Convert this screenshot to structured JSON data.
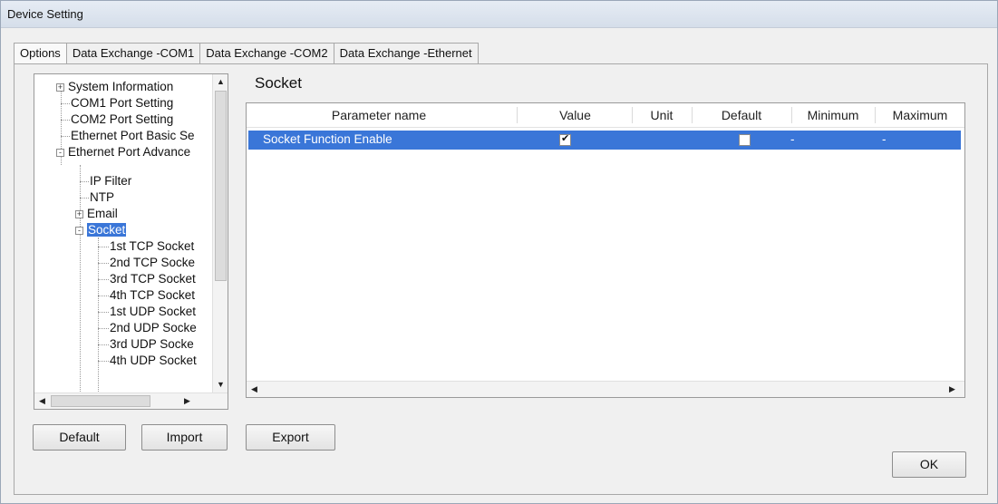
{
  "window": {
    "title": "Device Setting"
  },
  "tabs": [
    "Options",
    "Data Exchange -COM1",
    "Data Exchange -COM2",
    "Data Exchange -Ethernet"
  ],
  "tree": {
    "items": [
      {
        "label": "System Information",
        "expander": "+"
      },
      {
        "label": "COM1 Port Setting"
      },
      {
        "label": "COM2 Port Setting"
      },
      {
        "label": "Ethernet Port Basic Se"
      },
      {
        "label": "Ethernet Port Advance",
        "expander": "-"
      },
      {
        "label": "IP Filter"
      },
      {
        "label": "NTP"
      },
      {
        "label": "Email",
        "expander": "+"
      },
      {
        "label": "Socket",
        "expander": "-",
        "selected": true
      },
      {
        "label": "1st TCP Socket"
      },
      {
        "label": "2nd TCP Socke"
      },
      {
        "label": "3rd TCP Socket"
      },
      {
        "label": "4th TCP Socket"
      },
      {
        "label": "1st UDP Socket"
      },
      {
        "label": "2nd UDP Socke"
      },
      {
        "label": "3rd UDP Socke"
      },
      {
        "label": "4th UDP Socket"
      }
    ]
  },
  "panel": {
    "title": "Socket",
    "columns": [
      "Parameter name",
      "Value",
      "Unit",
      "Default",
      "Minimum",
      "Maximum"
    ],
    "rows": [
      {
        "name": "Socket Function Enable",
        "value_checked": true,
        "unit": "",
        "default_checked": false,
        "minimum": "-",
        "maximum": "-"
      }
    ]
  },
  "buttons": {
    "default": "Default",
    "import": "Import",
    "export": "Export",
    "ok": "OK"
  },
  "colors": {
    "selection": "#3a76d8"
  }
}
